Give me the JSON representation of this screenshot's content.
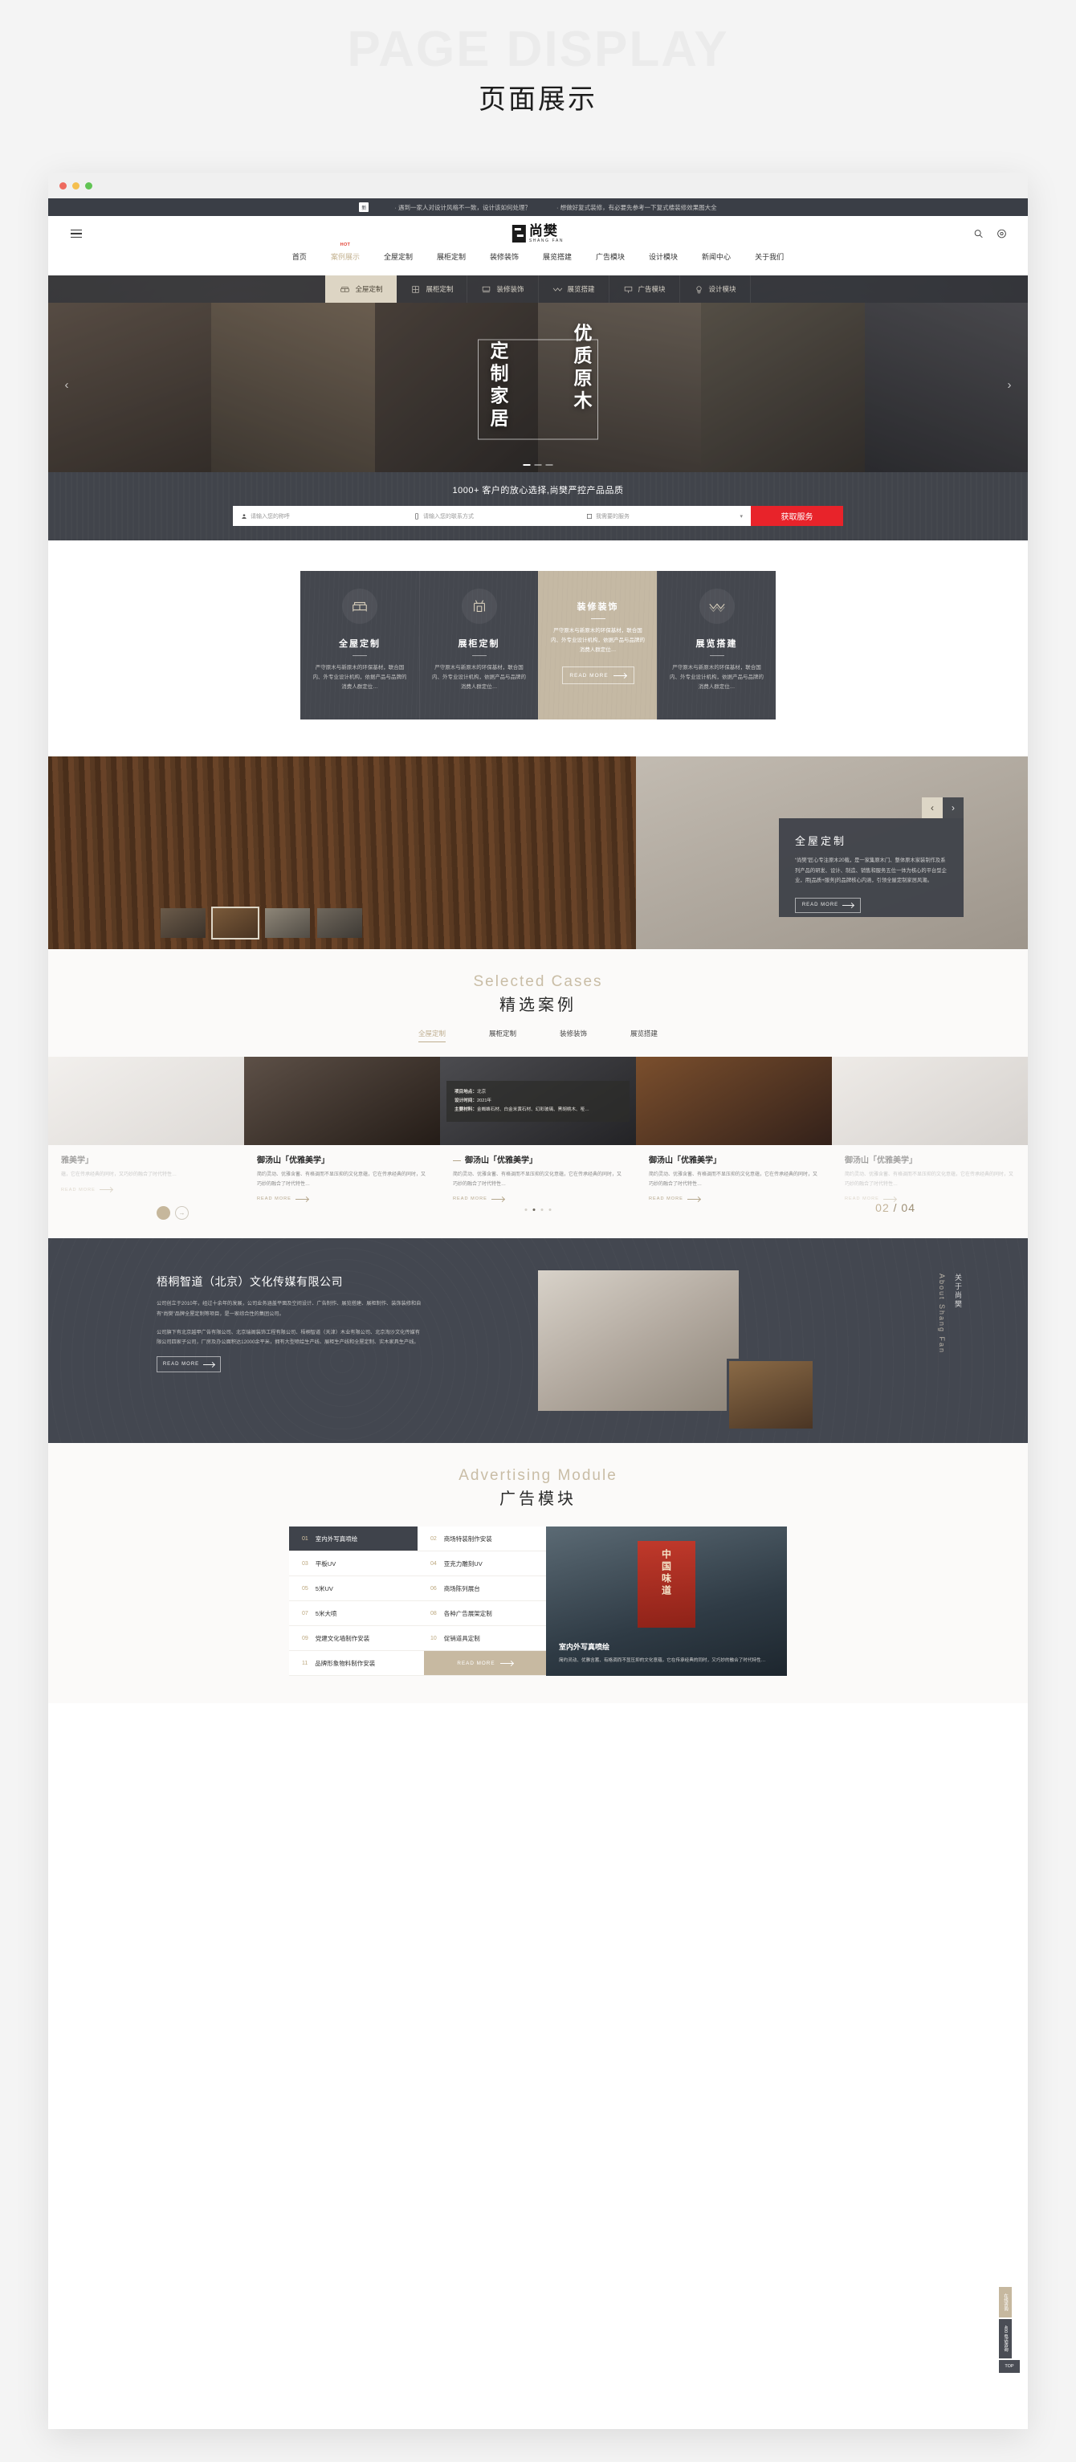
{
  "page": {
    "watermark": "PAGE DISPLAY",
    "title_zh": "页面展示"
  },
  "announce": {
    "badge": "新",
    "items": [
      "· 遇到一家人对设计风格不一致，设计该如何处理？",
      "· 想做好复式装修，有必要先参考一下复式楼装修效果图大全"
    ]
  },
  "brand": {
    "cn": "尚樊",
    "en": "SHANG FAN"
  },
  "nav": {
    "items": [
      {
        "label": "首页",
        "active": false
      },
      {
        "label": "案例展示",
        "active": true,
        "badge": "HOT"
      },
      {
        "label": "全屋定制",
        "active": false
      },
      {
        "label": "展柜定制",
        "active": false
      },
      {
        "label": "装修装饰",
        "active": false
      },
      {
        "label": "展览搭建",
        "active": false
      },
      {
        "label": "广告模块",
        "active": false
      },
      {
        "label": "设计模块",
        "active": false
      },
      {
        "label": "新闻中心",
        "active": false
      },
      {
        "label": "关于我们",
        "active": false
      }
    ]
  },
  "subnav": {
    "items": [
      {
        "label": "全屋定制",
        "icon": "sofa-icon",
        "active": true
      },
      {
        "label": "展柜定制",
        "icon": "cabinet-icon",
        "active": false
      },
      {
        "label": "装修装饰",
        "icon": "decor-icon",
        "active": false
      },
      {
        "label": "展览搭建",
        "icon": "wave-icon",
        "active": false
      },
      {
        "label": "广告模块",
        "icon": "billboard-icon",
        "active": false
      },
      {
        "label": "设计模块",
        "icon": "design-icon",
        "active": false
      }
    ]
  },
  "hero": {
    "line1": "优质原木",
    "line2": "定制家居",
    "prev": "‹",
    "next": "›"
  },
  "contact": {
    "heading": "1000+ 客户的放心选择,尚樊严控产品品质",
    "name_placeholder": "请输入您的称呼",
    "phone_placeholder": "请输入您的联系方式",
    "service_placeholder": "我需要的服务",
    "submit": "获取服务",
    "accent": "#e8232a"
  },
  "services": {
    "desc": "严守原木与新原木的环保基材，联合国内、外专业设计机构，依据产品与品牌的消费人群定位…",
    "read_more": "READ MORE",
    "cards": [
      {
        "title": "全屋定制",
        "icon": "sofa-icon",
        "active": false
      },
      {
        "title": "展柜定制",
        "icon": "cabinet-icon",
        "active": false
      },
      {
        "title": "装修装饰",
        "icon": "decor-icon",
        "active": true
      },
      {
        "title": "展览搭建",
        "icon": "wave-icon",
        "active": false
      }
    ]
  },
  "showcase": {
    "title": "全屋定制",
    "body": "“尚樊”匠心专注原木20载，是一家集原木门、整体原木家装制作及系列产品的研发、设计、制造、销售和服务五位一体为核心的平台型企业，用[品质+服务]的品牌核心内涵，引领全屋定制家居风潮。",
    "read_more": "READ MORE",
    "prev": "‹",
    "next": "›"
  },
  "cases": {
    "title_en": "Selected Cases",
    "title_cn": "精选案例",
    "tabs": [
      {
        "label": "全屋定制",
        "active": true
      },
      {
        "label": "展柜定制",
        "active": false
      },
      {
        "label": "装修装饰",
        "active": false
      },
      {
        "label": "展览搭建",
        "active": false
      }
    ],
    "detail": {
      "location_label": "项目地点：",
      "location": "北京",
      "date_label": "设计时间：",
      "date": "2021年",
      "material_label": "主要材料：",
      "material": "金蜘蛛石材、白金米黄石材、幻彩玻璃、黑胡桃木、哑…"
    },
    "items": [
      {
        "title": "雅美学」",
        "desc": "蕴，它在传承经典的同时，又巧妙的融合了时代特性…",
        "read_more": "READ MORE",
        "dash": ""
      },
      {
        "title": "御汤山「优雅美学」",
        "desc": "简约灵动、优雅含蓄、有格调而不显压抑的文化意蕴，它在传承经典的同时，又巧妙的融合了时代特性…",
        "read_more": "READ MORE",
        "dash": ""
      },
      {
        "title": "御汤山「优雅美学」",
        "desc": "简约灵动、优雅含蓄、有格调而不显压抑的文化意蕴，它在传承经典的同时，又巧妙的融合了时代特性…",
        "read_more": "READ MORE",
        "dash": "—"
      },
      {
        "title": "御汤山「优雅美学」",
        "desc": "简约灵动、优雅含蓄、有格调而不显压抑的文化意蕴，它在传承经典的同时，又巧妙的融合了时代特性…",
        "read_more": "READ MORE",
        "dash": ""
      },
      {
        "title": "御汤山「优雅美学」",
        "desc": "简约灵动、优雅含蓄、有格调而不显压抑的文化意蕴，它在传承经典的同时，又巧妙的融合了时代特性…",
        "read_more": "READ MORE",
        "dash": ""
      }
    ],
    "counter_current": "02",
    "counter_sep": "/",
    "counter_total": "04"
  },
  "about": {
    "title": "梧桐智道（北京）文化传媒有限公司",
    "p1": "公司创立于2010年，经过十余年的发展，公司业务涵盖平面及空间设计、广告制作、展览搭建、展柜制作、装饰装修和自有“尚樊”品牌全屋定制等项目，是一家综合性的集团公司。",
    "p2": "公司旗下有北京越甲广告有限公司、北京瑞阁装饰工程有限公司、梧桐智道（天津）木业有限公司、北京淘沙文化传媒有限公司四家子公司，厂房及办公面积达12000余平米，拥有大型喷绘生产线、展柜生产线和全屋定制、实木家具生产线。",
    "read_more": "READ MORE",
    "vert_cn": "关于尚樊",
    "vert_en": "About Shang Fan"
  },
  "ads": {
    "title_en": "Advertising Module",
    "title_cn": "广告模块",
    "read_more": "READ MORE",
    "items": [
      {
        "n": "01",
        "label": "室内外写真喷绘",
        "active": true
      },
      {
        "n": "02",
        "label": "商场特装制作安装",
        "active": false
      },
      {
        "n": "03",
        "label": "平板UV",
        "active": false
      },
      {
        "n": "04",
        "label": "亚克力雕刻UV",
        "active": false
      },
      {
        "n": "05",
        "label": "5米UV",
        "active": false
      },
      {
        "n": "06",
        "label": "商场陈列展台",
        "active": false
      },
      {
        "n": "07",
        "label": "5米大喷",
        "active": false
      },
      {
        "n": "08",
        "label": "各种广告展架定制",
        "active": false
      },
      {
        "n": "09",
        "label": "党建文化墙制作安装",
        "active": false
      },
      {
        "n": "10",
        "label": "促销道具定制",
        "active": false
      },
      {
        "n": "11",
        "label": "品牌形象物料制作安装",
        "active": false
      }
    ],
    "photo": {
      "poster_text": "中国味道",
      "title": "室内外写真喷绘",
      "desc": "简约灵动、优雅含蓄、有格调而不显压抑的文化意蕴，它在传承经典的同时，又巧妙的融合了时代特性…"
    }
  },
  "rail": {
    "items": [
      {
        "label": "在线咨询",
        "dark": false
      },
      {
        "label": "400 电话咨询",
        "dark": true
      }
    ],
    "top": "TOP"
  }
}
